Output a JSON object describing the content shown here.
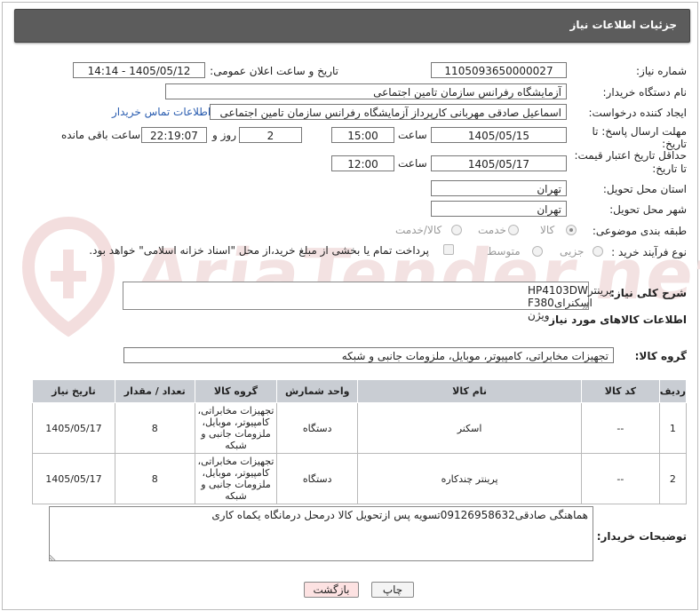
{
  "header": {
    "title": "جزئیات اطلاعات نیاز"
  },
  "labels": {
    "need_number": "شماره نیاز:",
    "announce_datetime": "تاریخ و ساعت اعلان عمومی:",
    "buyer_org": "نام دستگاه خریدار:",
    "requester": "ایجاد کننده درخواست:",
    "deadline_line1": "مهلت ارسال پاسخ: تا",
    "deadline_line2": "تاریخ:",
    "min_price_line1": "حداقل تاریخ اعتبار قیمت:",
    "min_price_line2": "تا تاریخ:",
    "delivery_province": "استان محل تحویل:",
    "delivery_city": "شهر محل تحویل:",
    "category": "طبقه بندی موضوعی:",
    "purchase_type": "نوع فرآیند خرید :",
    "hour": "ساعت",
    "day_and": "روز و",
    "hours_remaining": "ساعت باقی مانده"
  },
  "fields": {
    "need_number": "1105093650000027",
    "announce_datetime": "1405/05/12 - 14:14",
    "buyer_org": "آزمایشگاه رفرانس سازمان تامین اجتماعی",
    "requester": "اسماعیل صادقی مهربانی کارپرداز آزمایشگاه رفرانس سازمان تامین اجتماعی",
    "buyer_contact_link": "اطلاعات تماس خریدار",
    "deadline_date": "1405/05/15",
    "deadline_time": "15:00",
    "deadline_days": "2",
    "deadline_countdown": "22:19:07",
    "min_price_date": "1405/05/17",
    "min_price_time": "12:00",
    "delivery_province": "تهران",
    "delivery_city": "تهران"
  },
  "category_options": [
    {
      "label": "کالا",
      "selected": true
    },
    {
      "label": "خدمت",
      "selected": false
    },
    {
      "label": "کالا/خدمت",
      "selected": false
    }
  ],
  "purchase_options": [
    {
      "label": "جزیی",
      "selected": false
    },
    {
      "label": "متوسط",
      "selected": false
    }
  ],
  "payment_note": "پرداخت تمام یا بخشی از مبلغ خرید،از محل \"اسناد خزانه اسلامی\" خواهد بود.",
  "general_desc": {
    "label": "شرح کلی نیاز:",
    "line1": "HP4103DWپرینتر",
    "line2": "F380اسکنرای ویژن"
  },
  "goods_info_title": "اطلاعات کالاهای مورد نیاز",
  "goods_group": {
    "label": "گروه کالا:",
    "value": "تجهیزات مخابراتی، کامپیوتر، موبایل، ملزومات جانبی و شبکه"
  },
  "table": {
    "headers": [
      "ردیف",
      "کد کالا",
      "نام کالا",
      "واحد شمارش",
      "گروه کالا",
      "تعداد / مقدار",
      "تاریخ نیاز"
    ],
    "rows": [
      {
        "row": "1",
        "code": "--",
        "name": "اسکنر",
        "unit": "دستگاه",
        "group": "تجهیزات مخابراتی، کامپیوتر، موبایل، ملزومات جانبی و شبکه",
        "qty": "8",
        "date": "1405/05/17"
      },
      {
        "row": "2",
        "code": "--",
        "name": "پرینتر چندکاره",
        "unit": "دستگاه",
        "group": "تجهیزات مخابراتی، کامپیوتر، موبایل، ملزومات جانبی و شبکه",
        "qty": "8",
        "date": "1405/05/17"
      }
    ]
  },
  "buyer_notes": {
    "label": "توضیحات خریدار:",
    "text": "هماهنگی صادقی09126958632تسویه پس ازتحویل کالا درمحل درمانگاه یکماه کاری"
  },
  "buttons": {
    "print": "چاپ",
    "back": "بازگشت"
  },
  "colors": {
    "header_bg": "#5c5c5c",
    "table_header_bg": "#c9cdd3",
    "link": "#2a5db0",
    "back_button_bg": "#fde2e2"
  }
}
